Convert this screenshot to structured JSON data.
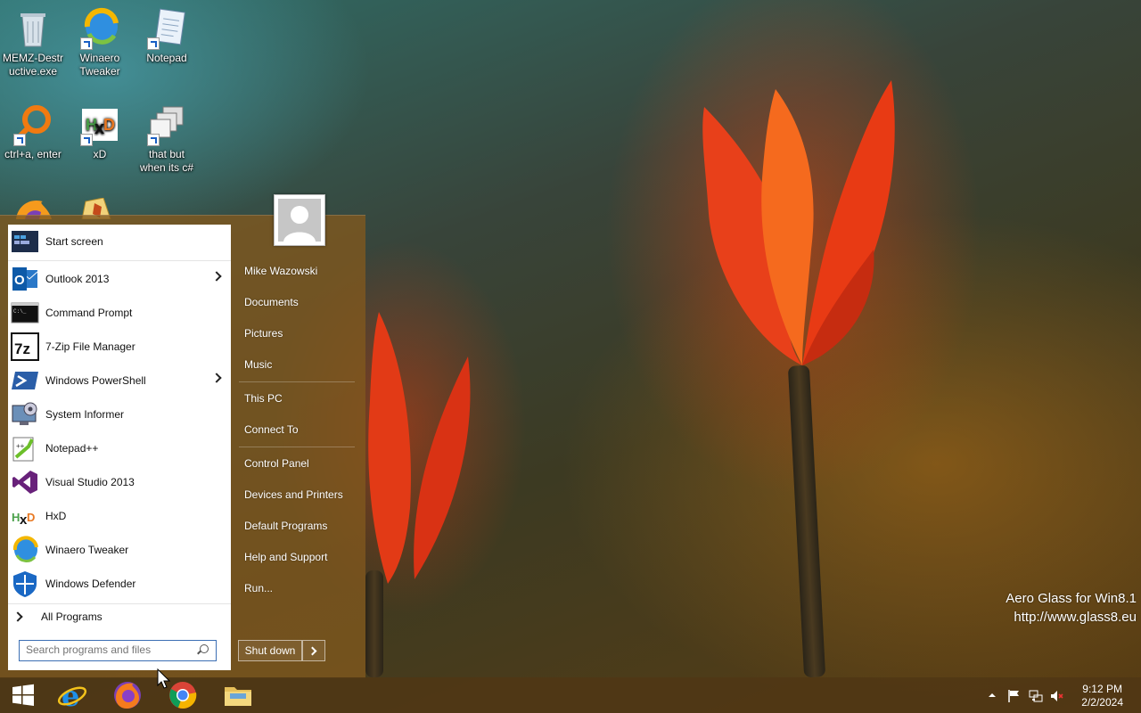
{
  "desktop": {
    "icons": [
      {
        "label": "MEMZ-Destructive.exe",
        "line1": "MEMZ-Destr",
        "line2": "uctive.exe",
        "icon": "recycle-bin-icon"
      },
      {
        "label": "Winaero Tweaker",
        "line1": "Winaero",
        "line2": "Tweaker",
        "icon": "winaero-icon"
      },
      {
        "label": "Notepad",
        "line1": "Notepad",
        "line2": "",
        "icon": "notepad-icon"
      },
      {
        "label": "ctrl+a, enter",
        "line1": "ctrl+a, enter",
        "line2": "",
        "icon": "magnifier-ring-icon"
      },
      {
        "label": "xD",
        "line1": "xD",
        "line2": "",
        "icon": "hxd-icon"
      },
      {
        "label": "that but when its c#",
        "line1": "that but",
        "line2": "when its c#",
        "icon": "windows-stack-icon"
      }
    ]
  },
  "start_menu": {
    "programs": [
      {
        "label": "Start screen",
        "icon": "start-screen-icon",
        "arrow": false
      },
      {
        "label": "Outlook 2013",
        "icon": "outlook-icon",
        "arrow": true
      },
      {
        "label": "Command Prompt",
        "icon": "command-prompt-icon",
        "arrow": false
      },
      {
        "label": "7-Zip File Manager",
        "icon": "7zip-icon",
        "arrow": false
      },
      {
        "label": "Windows PowerShell",
        "icon": "powershell-icon",
        "arrow": true
      },
      {
        "label": "System Informer",
        "icon": "system-informer-icon",
        "arrow": false
      },
      {
        "label": "Notepad++",
        "icon": "notepad-plus-plus-icon",
        "arrow": false
      },
      {
        "label": "Visual Studio 2013",
        "icon": "visual-studio-icon",
        "arrow": false
      },
      {
        "label": "HxD",
        "icon": "hxd-icon",
        "arrow": false
      },
      {
        "label": "Winaero Tweaker",
        "icon": "winaero-icon",
        "arrow": false
      },
      {
        "label": "Windows Defender",
        "icon": "windows-defender-icon",
        "arrow": false
      }
    ],
    "all_programs": "All Programs",
    "search_placeholder": "Search programs and files",
    "right_items": {
      "user": "Mike Wazowski",
      "documents": "Documents",
      "pictures": "Pictures",
      "music": "Music",
      "this_pc": "This PC",
      "connect_to": "Connect To",
      "control_panel": "Control Panel",
      "devices": "Devices and Printers",
      "default_programs": "Default Programs",
      "help": "Help and Support",
      "run": "Run..."
    },
    "shutdown_label": "Shut down"
  },
  "watermark": {
    "line1": "Aero Glass for Win8.1",
    "line2": "http://www.glass8.eu"
  },
  "taskbar": {
    "apps": [
      "start-button",
      "internet-explorer",
      "firefox",
      "chrome",
      "file-explorer"
    ],
    "time": "9:12 PM",
    "date": "2/2/2024"
  },
  "colors": {
    "start_glass": "#82581e",
    "taskbar_glass": "#50371a",
    "accent_blue": "#3c6fb4"
  }
}
